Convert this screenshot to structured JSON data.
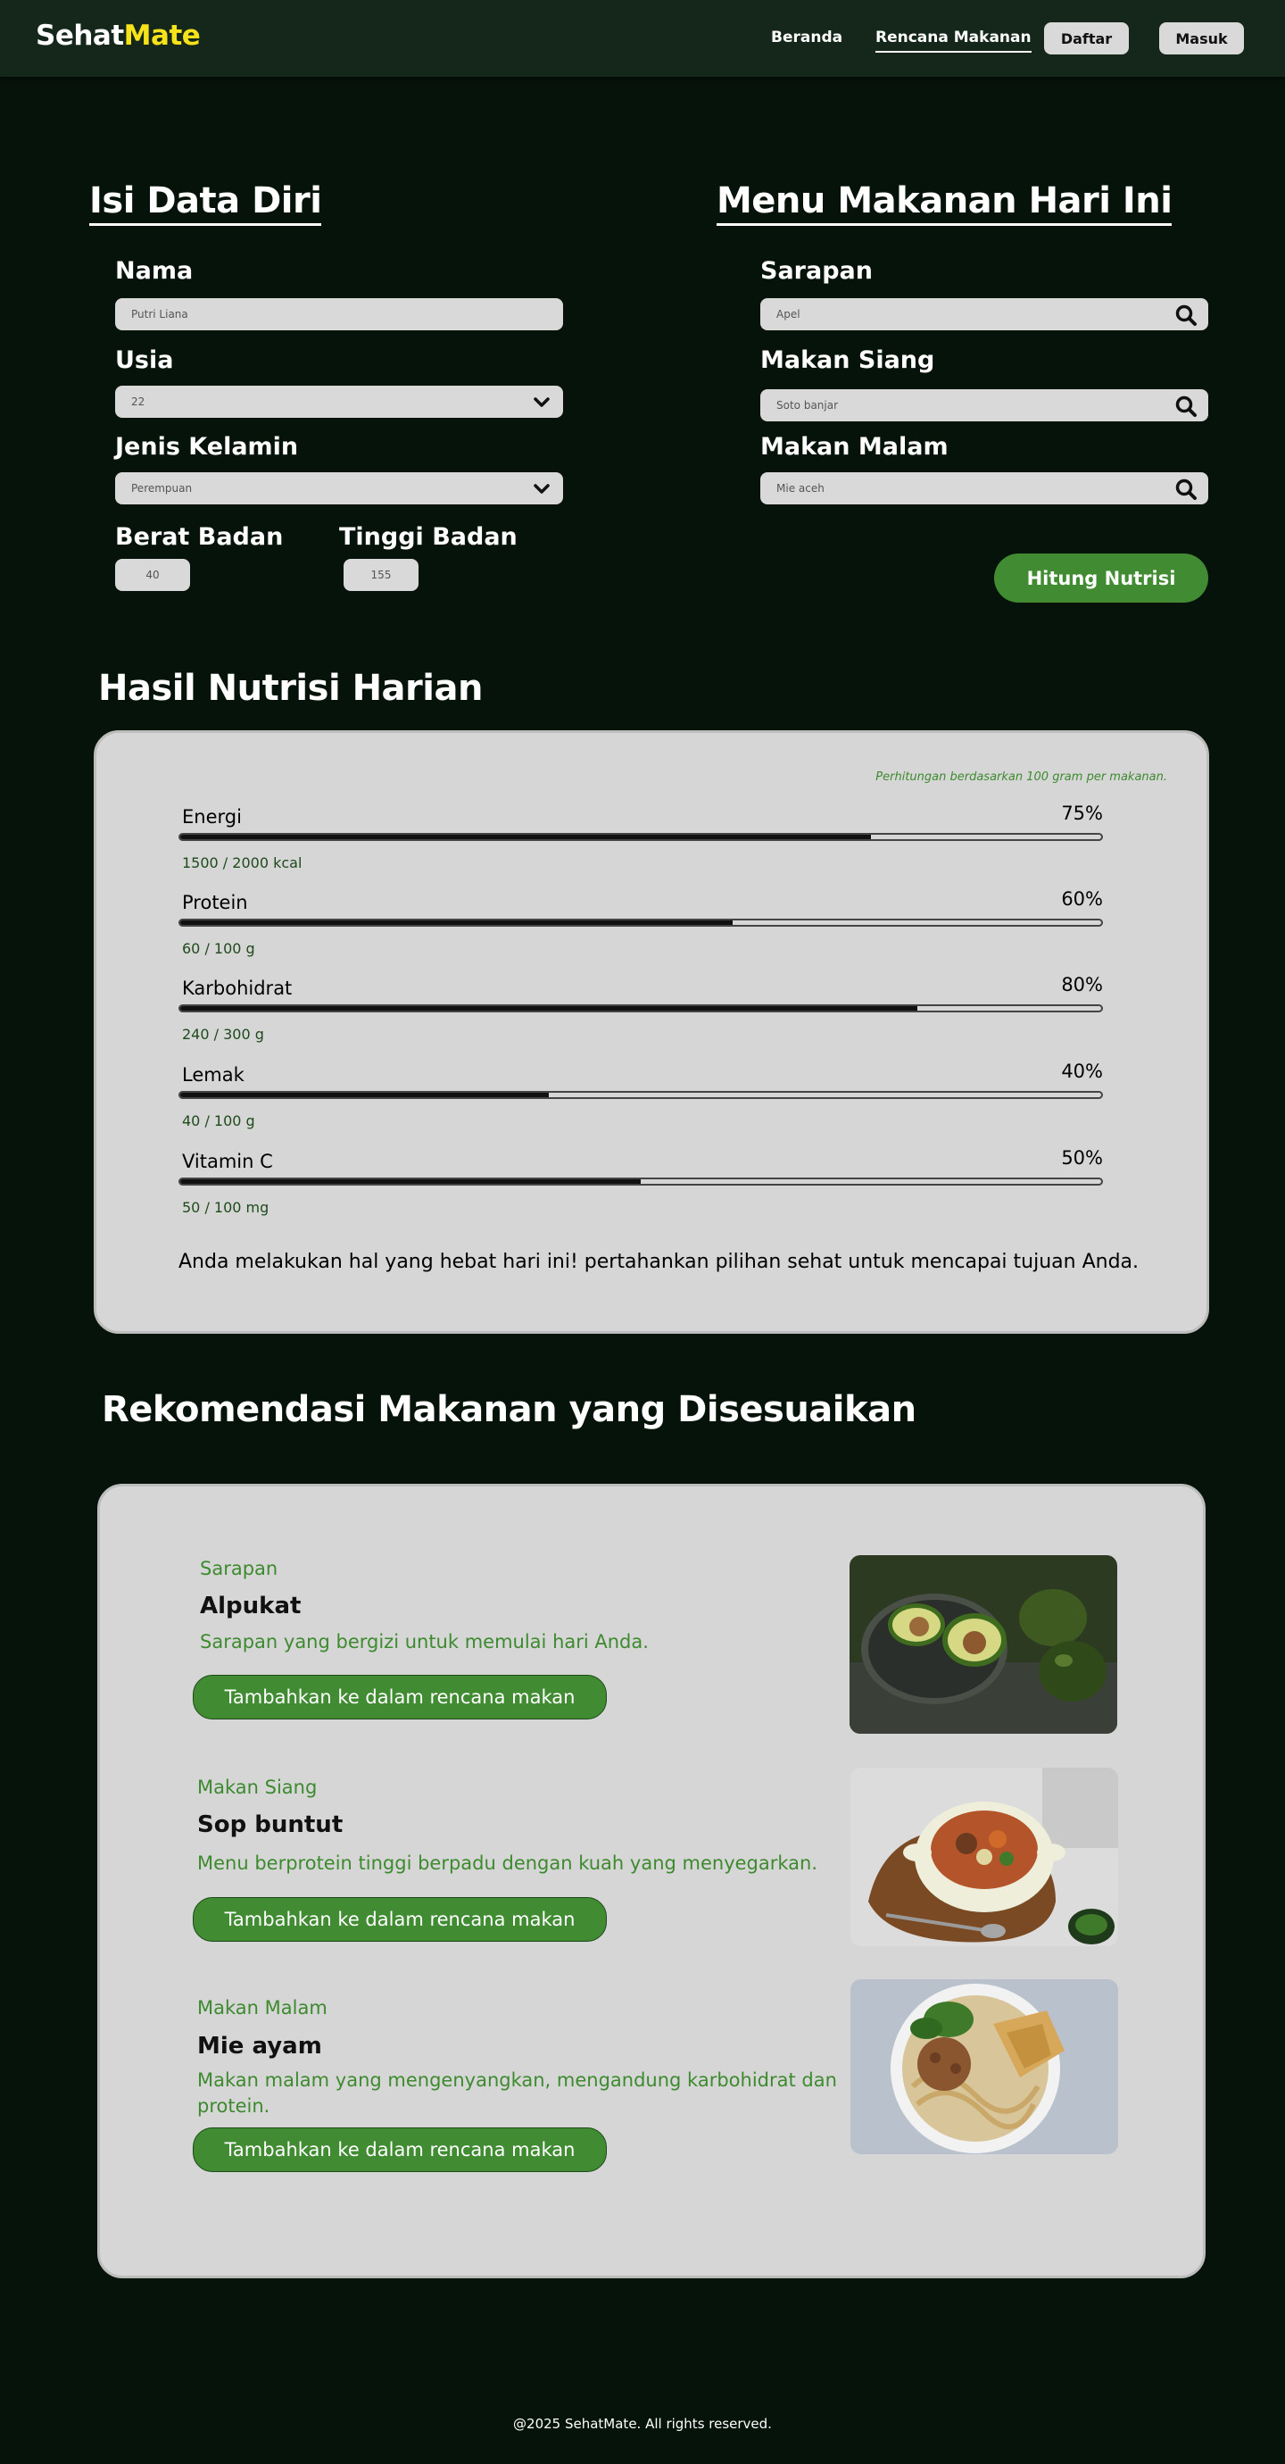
{
  "brand": {
    "part1": "Sehat",
    "part2": "Mate"
  },
  "nav": {
    "home": "Beranda",
    "plan": "Rencana Makanan",
    "register": "Daftar",
    "login": "Masuk"
  },
  "profile": {
    "title": "Isi Data Diri",
    "name_label": "Nama",
    "name_value": "Putri Liana",
    "age_label": "Usia",
    "age_value": "22",
    "gender_label": "Jenis Kelamin",
    "gender_value": "Perempuan",
    "weight_label": "Berat Badan",
    "weight_value": "40",
    "height_label": "Tinggi Badan",
    "height_value": "155"
  },
  "menu": {
    "title": "Menu Makanan Hari Ini",
    "breakfast_label": "Sarapan",
    "breakfast_value": "Apel",
    "lunch_label": "Makan Siang",
    "lunch_value": "Soto banjar",
    "dinner_label": "Makan Malam",
    "dinner_value": "Mie aceh",
    "calc_button": "Hitung Nutrisi"
  },
  "nutrition": {
    "title": "Hasil Nutrisi Harian",
    "note": "Perhitungan berdasarkan 100 gram per makanan.",
    "items": [
      {
        "label": "Energi",
        "percent": "75%",
        "fill": 0.75,
        "amount": "1500 / 2000 kcal"
      },
      {
        "label": "Protein",
        "percent": "60%",
        "fill": 0.6,
        "amount": "60 / 100 g"
      },
      {
        "label": "Karbohidrat",
        "percent": "80%",
        "fill": 0.8,
        "amount": "240 / 300 g"
      },
      {
        "label": "Lemak",
        "percent": "40%",
        "fill": 0.4,
        "amount": "40 / 100 g"
      },
      {
        "label": "Vitamin C",
        "percent": "50%",
        "fill": 0.5,
        "amount": "50 / 100 mg"
      }
    ],
    "message": "Anda melakukan hal yang hebat hari ini! pertahankan pilihan sehat untuk mencapai tujuan Anda."
  },
  "recommendations": {
    "title": "Rekomendasi Makanan yang Disesuaikan",
    "items": [
      {
        "category": "Sarapan",
        "name": "Alpukat",
        "desc": "Sarapan yang bergizi untuk memulai hari Anda.",
        "button": "Tambahkan ke dalam rencana makan"
      },
      {
        "category": "Makan Siang",
        "name": "Sop buntut",
        "desc": "Menu berprotein tinggi berpadu dengan kuah yang menyegarkan.",
        "button": "Tambahkan ke dalam rencana makan"
      },
      {
        "category": "Makan Malam",
        "name": "Mie ayam",
        "desc": "Makan malam yang mengenyangkan, mengandung karbohidrat dan protein.",
        "button": "Tambahkan ke dalam rencana makan"
      }
    ]
  },
  "footer": {
    "text": "@2025 SehatMate. All rights reserved."
  },
  "colors": {
    "accent_green": "#418b32",
    "brand_yellow": "#f6e21a",
    "background": "#06130a",
    "card": "#d6d6d6"
  }
}
